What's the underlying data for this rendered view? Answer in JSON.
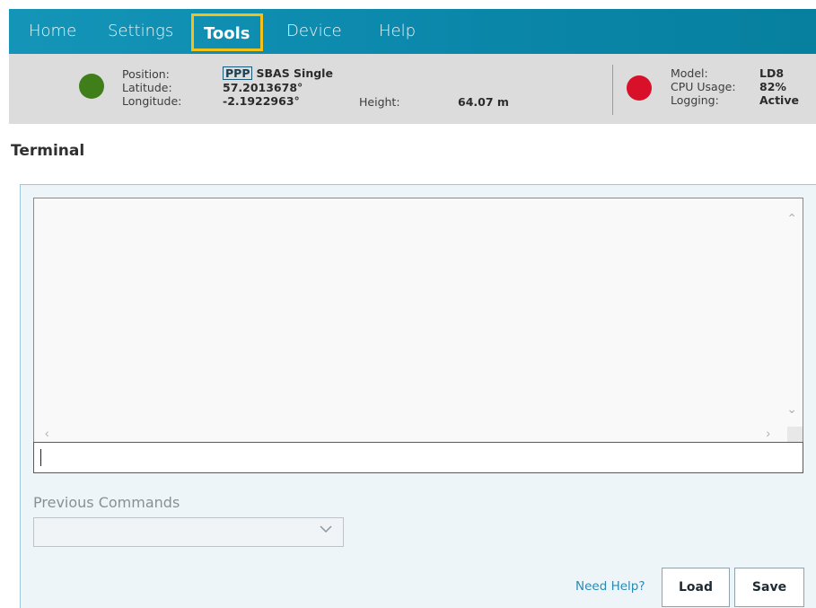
{
  "nav": {
    "items": [
      {
        "label": "Home"
      },
      {
        "label": "Settings"
      },
      {
        "label": "Tools"
      },
      {
        "label": "Device"
      },
      {
        "label": "Help"
      }
    ],
    "active": "Tools",
    "highlight_color": "#f2c21a"
  },
  "status": {
    "position_label": "Position:",
    "position_badge": "PPP",
    "position_value": "SBAS Single",
    "latitude_label": "Latitude:",
    "latitude_value": "57.2013678°",
    "longitude_label": "Longitude:",
    "longitude_value": "-2.1922963°",
    "height_label": "Height:",
    "height_value": "64.07 m",
    "model_label": "Model:",
    "model_value": "LD8",
    "cpu_label": "CPU Usage:",
    "cpu_value": "82%",
    "logging_label": "Logging:",
    "logging_value": "Active",
    "position_indicator_color": "#3f7e19",
    "device_indicator_color": "#d8102a"
  },
  "page": {
    "title": "Terminal"
  },
  "terminal": {
    "output": "",
    "command_value": "",
    "previous_label": "Previous Commands",
    "previous_selected": "",
    "help_link": "Need Help?",
    "load_label": "Load",
    "save_label": "Save"
  }
}
